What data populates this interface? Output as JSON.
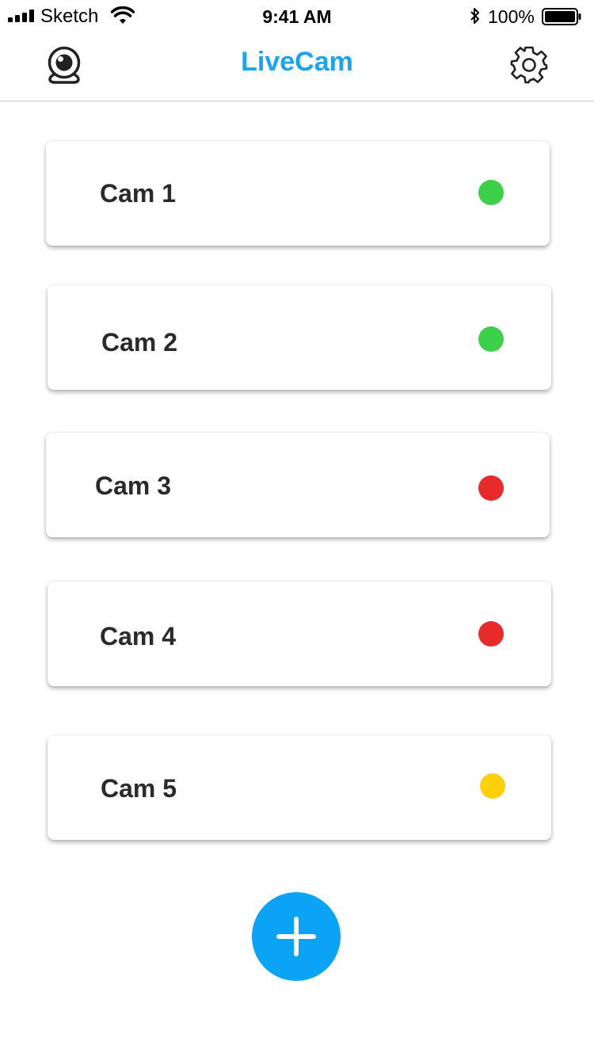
{
  "status_bar": {
    "carrier": "Sketch",
    "time": "9:41 AM",
    "battery": "100%"
  },
  "nav": {
    "title": "LiveCam",
    "title_color": "#1aa3ee",
    "left_icon": "webcam-icon",
    "right_icon": "gear-icon"
  },
  "cameras": [
    {
      "label": "Cam 1",
      "status_color": "#3ecf4a"
    },
    {
      "label": "Cam 2",
      "status_color": "#3ecf4a"
    },
    {
      "label": "Cam 3",
      "status_color": "#e82a2a"
    },
    {
      "label": "Cam 4",
      "status_color": "#e82a2a"
    },
    {
      "label": "Cam 5",
      "status_color": "#fdd00a"
    }
  ],
  "fab": {
    "icon": "plus-icon",
    "color": "#0aa3f5"
  }
}
